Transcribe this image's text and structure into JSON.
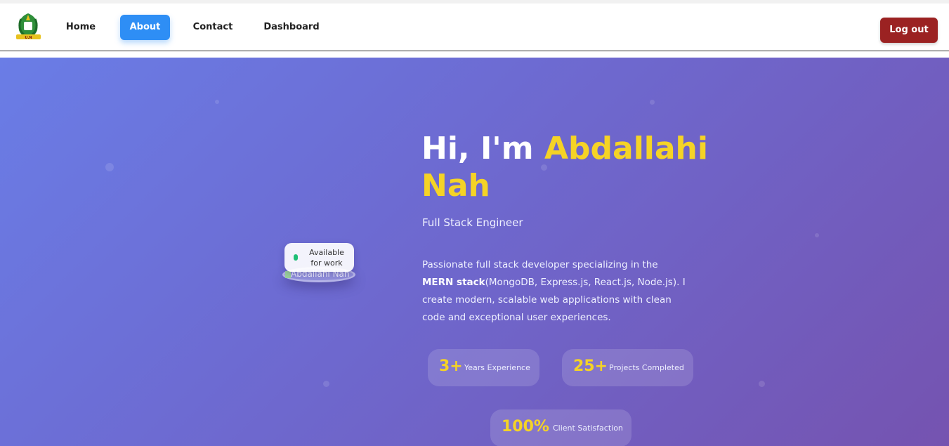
{
  "nav": {
    "logo_icon": "university-crest-logo",
    "links": [
      {
        "label": "Home"
      },
      {
        "label": "About"
      },
      {
        "label": "Contact"
      },
      {
        "label": "Dashboard"
      }
    ],
    "active": "About",
    "logout_label": "Log out",
    "colors": {
      "active": "#2e8ef5",
      "logout": "#9b2222"
    }
  },
  "hero": {
    "greeting": "Hi, I'm ",
    "name": "Abdallahi Nah",
    "role": "Full Stack Engineer",
    "description_parts": {
      "before": "Passionate full stack developer specializing in the ",
      "bold": "MERN stack",
      "after": "(MongoDB, Express.js, React.js, Node.js). I create modern, scalable web applications with clean code and exceptional user experiences."
    },
    "badge": "Available for work",
    "avatar_alt": "Abdallahi Nah",
    "colors": {
      "accent": "#f5d326",
      "gradient_start": "#6a7de6",
      "gradient_end": "#7553b0",
      "status": "#1fbf76"
    }
  },
  "stats": [
    {
      "number": "3+",
      "label": "Years Experience"
    },
    {
      "number": "25+",
      "label": "Projects Completed"
    },
    {
      "number": "100%",
      "label": "Client Satisfaction"
    }
  ]
}
